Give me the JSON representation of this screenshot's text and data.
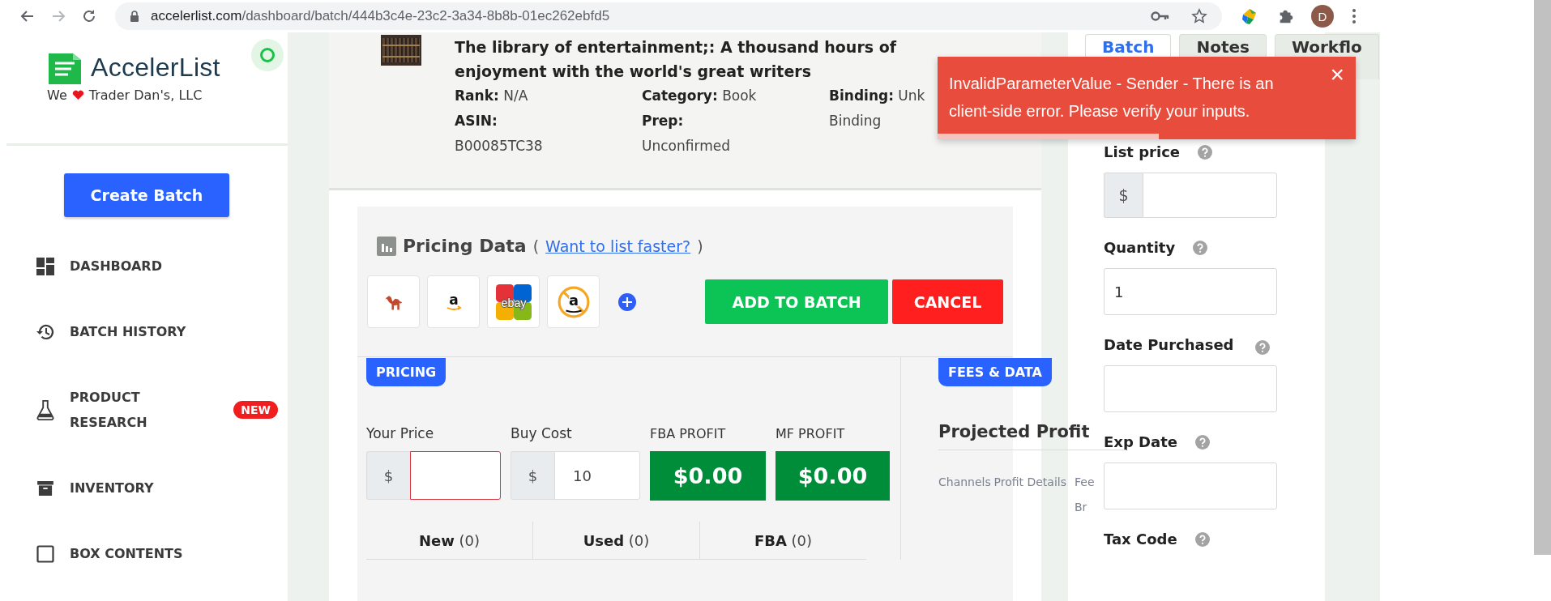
{
  "browser": {
    "url_host": "accelerlist.com",
    "url_path": "/dashboard/batch/444b3c4e-23c2-3a34-8b8b-01ec262ebfd5",
    "avatar": "D"
  },
  "sidebar": {
    "logo": "AccelerList",
    "tagline_before": "We",
    "tagline_after": "Trader Dan's, LLC",
    "create_button": "Create Batch",
    "items": [
      {
        "label": "DASHBOARD",
        "kind": "dashboard"
      },
      {
        "label": "BATCH HISTORY",
        "kind": "history"
      },
      {
        "label": "PRODUCT RESEARCH",
        "kind": "research",
        "badge": "NEW"
      },
      {
        "label": "INVENTORY",
        "kind": "inventory"
      },
      {
        "label": "BOX CONTENTS",
        "kind": "box"
      }
    ]
  },
  "product": {
    "title": "The library of entertainment;: A thousand hours of enjoyment with the world's great writers",
    "meta": [
      [
        {
          "kind": "inline",
          "label": "Rank:",
          "value": "N/A"
        },
        {
          "kind": "stacked",
          "label": "ASIN:",
          "value": "B00085TC38"
        }
      ],
      [
        {
          "kind": "inline",
          "label": "Category:",
          "value": "Book"
        },
        {
          "kind": "stacked",
          "label": "Prep:",
          "value": "Unconfirmed"
        }
      ],
      [
        {
          "kind": "inline",
          "label": "Binding:",
          "value": "Unk"
        },
        {
          "kind": "continuation",
          "value": "Binding"
        }
      ]
    ]
  },
  "pricing": {
    "title": "Pricing Data",
    "paren_open": "(",
    "link": "Want to list faster?",
    "paren_close": ")",
    "channels": [
      {
        "kind": "camel"
      },
      {
        "kind": "amazon",
        "glyph": "a"
      },
      {
        "kind": "ebay",
        "glyph": "ebay"
      },
      {
        "kind": "amazon_blocked",
        "glyph": "a"
      }
    ],
    "add_button": "ADD TO BATCH",
    "cancel_button": "CANCEL",
    "pricing_tag": "PRICING",
    "fees_tag": "FEES & DATA",
    "inputs": [
      {
        "label": "Your Price",
        "prefix": "$",
        "invalid": true
      },
      {
        "label": "Buy Cost",
        "prefix": "$",
        "value": "10",
        "invalid": false
      }
    ],
    "profits": [
      {
        "label": "FBA PROFIT",
        "value": "$0.00"
      },
      {
        "label": "MF PROFIT",
        "value": "$0.00"
      }
    ],
    "offer_tabs": [
      {
        "label": "New",
        "count": "(0)"
      },
      {
        "label": "Used",
        "count": "(0)"
      },
      {
        "label": "FBA",
        "count": "(0)"
      }
    ],
    "fees": {
      "title": "Projected Profit",
      "columns": [
        "Channels",
        "Profit Details",
        "Fee Br"
      ]
    }
  },
  "right_panel": {
    "tabs": [
      {
        "label": "Batch",
        "selected": true
      },
      {
        "label": "Notes",
        "selected": false
      },
      {
        "label": "Workflo",
        "selected": false
      }
    ],
    "fields": [
      {
        "label": "List price",
        "kind": "money",
        "prefix": "$",
        "help": true
      },
      {
        "label": "Quantity",
        "kind": "text",
        "value": "1",
        "help": true
      },
      {
        "label": "Date Purchased",
        "kind": "text",
        "help": true
      },
      {
        "label": "Exp Date",
        "kind": "text",
        "help": true
      },
      {
        "label": "Tax Code",
        "kind": "none",
        "help": true
      }
    ]
  },
  "toast": {
    "message": "InvalidParameterValue - Sender - There is an client-side error. Please verify your inputs.",
    "close": "×",
    "level": 0.53
  }
}
